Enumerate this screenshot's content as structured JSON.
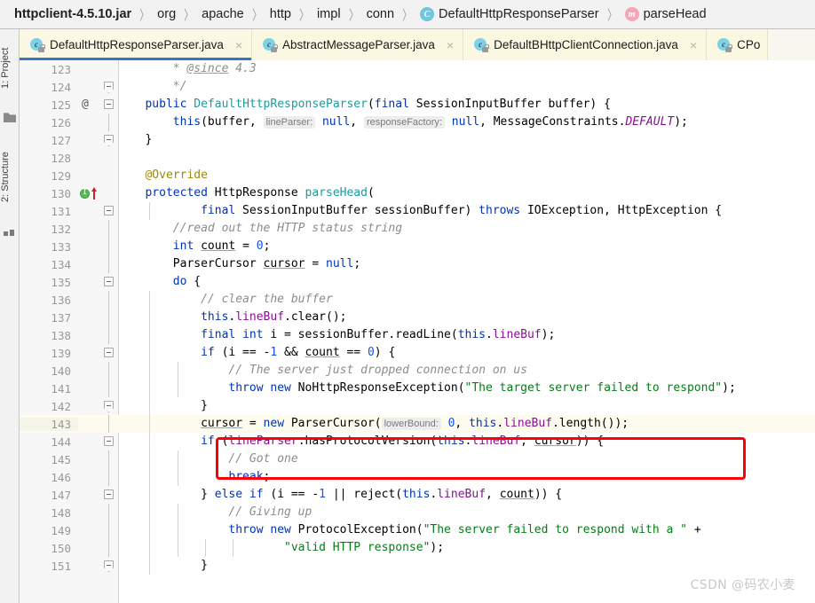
{
  "breadcrumb": {
    "items": [
      {
        "label": "httpclient-4.5.10.jar",
        "icon": "",
        "bold": true
      },
      {
        "label": "org",
        "icon": ""
      },
      {
        "label": "apache",
        "icon": ""
      },
      {
        "label": "http",
        "icon": ""
      },
      {
        "label": "impl",
        "icon": ""
      },
      {
        "label": "conn",
        "icon": ""
      },
      {
        "label": "DefaultHttpResponseParser",
        "icon": "class-icon",
        "icon_letter": "C"
      },
      {
        "label": "parseHead",
        "icon": "method-icon",
        "icon_letter": "m"
      }
    ],
    "separator": "〉"
  },
  "tool_strip": {
    "project_label": "1: Project",
    "structure_label": "2: Structure",
    "project_num": "1",
    "structure_num": "2",
    "folder_icon": "folder-icon",
    "squares_icon": "modules-icon"
  },
  "tabs": [
    {
      "label": "DefaultHttpResponseParser.java",
      "icon_letter": "c",
      "active": true,
      "close": "×"
    },
    {
      "label": "AbstractMessageParser.java",
      "icon_letter": "c",
      "active": false,
      "close": "×"
    },
    {
      "label": "DefaultBHttpClientConnection.java",
      "icon_letter": "c",
      "active": false,
      "close": "×"
    },
    {
      "label": "CPo",
      "icon_letter": "c",
      "active": false,
      "close": "×",
      "clipped": true
    }
  ],
  "editor": {
    "caret_line": 143,
    "accent_color": "#3675c8",
    "annotation_box_color": "#fb0007",
    "lines": [
      {
        "num": "123",
        "fold": "none",
        "mark": "",
        "text_html": "       <span class=\"cmt\">* </span><span class=\"cmt undl\">@since</span><span class=\"cmt\"> 4.3</span>"
      },
      {
        "num": "124",
        "fold": "end",
        "mark": "",
        "text_html": "       <span class=\"cmt\">*/</span>"
      },
      {
        "num": "125",
        "fold": "start",
        "mark": "at",
        "text_html": "   <span class=\"kw\">public</span> <span class=\"cls2\">DefaultHttpResponseParser</span>(<span class=\"kw\">final</span> SessionInputBuffer buffer) {"
      },
      {
        "num": "126",
        "fold": "bar",
        "mark": "",
        "text_html": "       <span class=\"kw\">this</span>(buffer, <span class=\"hint\">lineParser:</span> <span class=\"kw\">null</span>, <span class=\"hint\">responseFactory:</span> <span class=\"kw\">null</span>, MessageConstraints.<span class=\"sfld\">DEFAULT</span>);"
      },
      {
        "num": "127",
        "fold": "end",
        "mark": "",
        "text_html": "   }"
      },
      {
        "num": "128",
        "fold": "none",
        "mark": "",
        "text_html": ""
      },
      {
        "num": "129",
        "fold": "none",
        "mark": "",
        "text_html": "   <span class=\"anno\">@Override</span>"
      },
      {
        "num": "130",
        "fold": "none",
        "mark": "impl",
        "text_html": "   <span class=\"kw\">protected</span> HttpResponse <span class=\"cls2\">parseHead</span>("
      },
      {
        "num": "131",
        "fold": "start",
        "mark": "",
        "text_html": "           <span class=\"kw\">final</span> SessionInputBuffer sessionBuffer) <span class=\"kw\">throws</span> IOException, HttpException {"
      },
      {
        "num": "132",
        "fold": "bar",
        "mark": "",
        "text_html": "       <span class=\"cmt\">//read out the HTTP status string</span>"
      },
      {
        "num": "133",
        "fold": "bar",
        "mark": "",
        "text_html": "       <span class=\"kw\">int</span> <span class=\"undl\">count</span> = <span class=\"num2\">0</span>;"
      },
      {
        "num": "134",
        "fold": "bar",
        "mark": "",
        "text_html": "       ParserCursor <span class=\"undl\">cursor</span> = <span class=\"kw\">null</span>;"
      },
      {
        "num": "135",
        "fold": "start",
        "mark": "",
        "text_html": "       <span class=\"kw\">do</span> {"
      },
      {
        "num": "136",
        "fold": "bar",
        "mark": "",
        "text_html": "           <span class=\"cmt\">// clear the buffer</span>"
      },
      {
        "num": "137",
        "fold": "bar",
        "mark": "",
        "text_html": "           <span class=\"kw\">this</span>.<span class=\"fld\">lineBuf</span>.clear();"
      },
      {
        "num": "138",
        "fold": "bar",
        "mark": "",
        "text_html": "           <span class=\"kw\">final</span> <span class=\"kw\">int</span> i = sessionBuffer.readLine(<span class=\"kw\">this</span>.<span class=\"fld\">lineBuf</span>);"
      },
      {
        "num": "139",
        "fold": "start",
        "mark": "",
        "text_html": "           <span class=\"kw\">if</span> (i == -<span class=\"num2\">1</span> &amp;&amp; <span class=\"undl\">count</span> == <span class=\"num2\">0</span>) {"
      },
      {
        "num": "140",
        "fold": "bar",
        "mark": "",
        "text_html": "               <span class=\"cmt\">// The server just dropped connection on us</span>"
      },
      {
        "num": "141",
        "fold": "bar",
        "mark": "",
        "text_html": "               <span class=\"kw\">throw</span> <span class=\"kw\">new</span> NoHttpResponseException(<span class=\"str\">\"The target server failed to respond\"</span>);"
      },
      {
        "num": "142",
        "fold": "end",
        "mark": "",
        "text_html": "           }"
      },
      {
        "num": "143",
        "fold": "bar",
        "mark": "",
        "text_html": "           <span class=\"undl\">cursor</span> = <span class=\"kw\">new</span> ParserCursor(<span class=\"hint\">lowerBound:</span> <span class=\"num2\">0</span>, <span class=\"kw\">this</span>.<span class=\"fld\">lineBuf</span>.length());"
      },
      {
        "num": "144",
        "fold": "start",
        "mark": "",
        "text_html": "           <span class=\"kw\">if</span> (<span class=\"fld\">lineParser</span>.hasProtocolVersion(<span class=\"kw\">this</span>.<span class=\"fld\">lineBuf</span>, <span class=\"undl\">cursor</span>)) {"
      },
      {
        "num": "145",
        "fold": "bar",
        "mark": "",
        "text_html": "               <span class=\"cmt\">// Got one</span>"
      },
      {
        "num": "146",
        "fold": "bar",
        "mark": "",
        "text_html": "               <span class=\"kw\">break</span>;"
      },
      {
        "num": "147",
        "fold": "start",
        "mark": "",
        "text_html": "           } <span class=\"kw\">else</span> <span class=\"kw\">if</span> (i == -<span class=\"num2\">1</span> || reject(<span class=\"kw\">this</span>.<span class=\"fld\">lineBuf</span>, <span class=\"undl\">count</span>)) {"
      },
      {
        "num": "148",
        "fold": "bar",
        "mark": "",
        "text_html": "               <span class=\"cmt\">// Giving up</span>"
      },
      {
        "num": "149",
        "fold": "bar",
        "mark": "",
        "text_html": "               <span class=\"kw\">throw</span> <span class=\"kw\">new</span> ProtocolException(<span class=\"str\">\"The server failed to respond with a \"</span> +"
      },
      {
        "num": "150",
        "fold": "bar",
        "mark": "",
        "text_html": "                       <span class=\"str\">\"valid HTTP response\"</span>);"
      },
      {
        "num": "151",
        "fold": "end",
        "mark": "",
        "text_html": "           }"
      }
    ]
  },
  "watermark": {
    "text": "CSDN @码农小麦"
  }
}
